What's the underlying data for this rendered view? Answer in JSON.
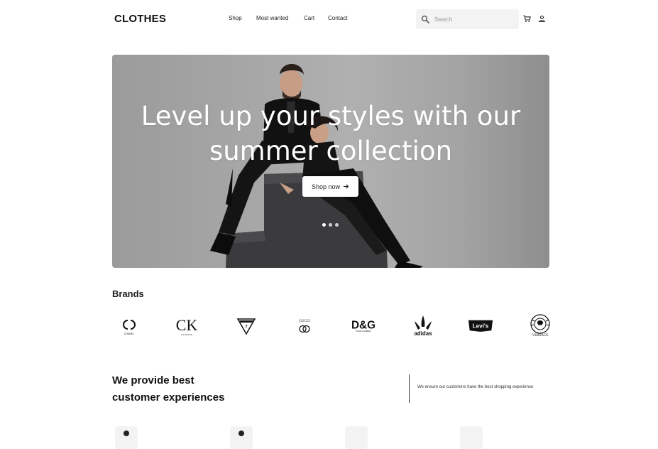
{
  "header": {
    "logo": "CLOTHES",
    "nav": [
      {
        "label": "Shop"
      },
      {
        "label": "Most wanted"
      },
      {
        "label": "Cart"
      },
      {
        "label": "Contact"
      }
    ],
    "search": {
      "placeholder": "Search",
      "value": ""
    },
    "icons": [
      "cart-icon",
      "user-icon"
    ]
  },
  "hero": {
    "title_line1": "Level up your styles with our",
    "title_line2": "summer collection",
    "button_label": "Shop now",
    "slides_count": 3,
    "active_slide": 1
  },
  "brands": {
    "title": "Brands",
    "items": [
      "Chanel",
      "Calvin Klein",
      "Guess",
      "Gucci",
      "D&G",
      "adidas",
      "Levi's",
      "Versace"
    ],
    "logo_text": {
      "chanel_sub": "CHANEL",
      "ck": "CK",
      "ck_sub": "Calvin Klein",
      "guess_mark": "?",
      "gucci": "GUCCI",
      "dg": "D&G",
      "dg_sub": "DOLCE & GABBANA",
      "adidas": "adidas",
      "levis": "Levi's",
      "versace": "VERSACE"
    }
  },
  "experience": {
    "title_line1": "We provide best",
    "title_line2": "customer experiences",
    "text": "We ensure our customers have the best shopping experience"
  },
  "colors": {
    "text": "#111111",
    "search_bg": "#f3f3f3",
    "hero_bg": "#a6a6a6",
    "button_bg": "#ffffff"
  }
}
